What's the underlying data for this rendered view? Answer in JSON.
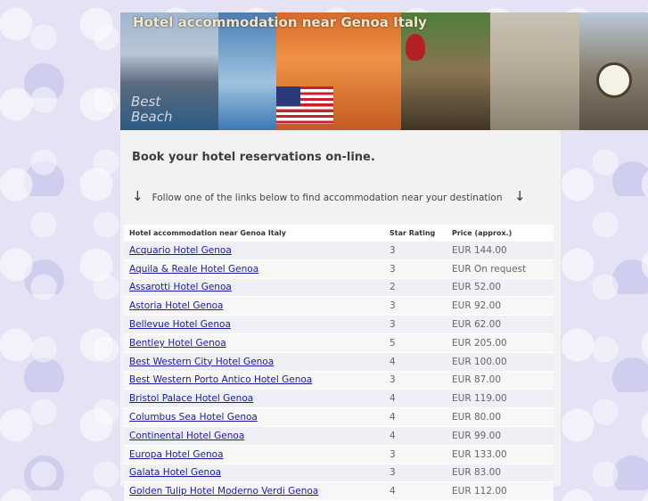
{
  "header": {
    "site_title": "Hotel accommodation near Genoa Italy",
    "banner_text": "Best Beach"
  },
  "intro": {
    "tagline": "Book your hotel reservations on-line.",
    "follow_text": "Follow one of the links below to find accommodation near your destination",
    "arrow_glyph": "↓"
  },
  "table": {
    "headers": {
      "name": "Hotel accommodation near Genoa Italy",
      "star": "Star Rating",
      "price": "Price (approx.)"
    },
    "rows": [
      {
        "name": "Acquario Hotel Genoa",
        "star": "3",
        "price": "EUR 144.00"
      },
      {
        "name": "Aquila & Reale Hotel Genoa",
        "star": "3",
        "price": "EUR On request"
      },
      {
        "name": "Assarotti Hotel Genoa",
        "star": "2",
        "price": "EUR 52.00"
      },
      {
        "name": "Astoria Hotel Genoa",
        "star": "3",
        "price": "EUR 92.00"
      },
      {
        "name": "Bellevue Hotel Genoa",
        "star": "3",
        "price": "EUR 62.00"
      },
      {
        "name": "Bentley Hotel Genoa",
        "star": "5",
        "price": "EUR 205.00"
      },
      {
        "name": "Best Western City Hotel Genoa",
        "star": "4",
        "price": "EUR 100.00"
      },
      {
        "name": "Best Western Porto Antico Hotel Genoa",
        "star": "3",
        "price": "EUR 87.00"
      },
      {
        "name": "Bristol Palace Hotel Genoa",
        "star": "4",
        "price": "EUR 119.00"
      },
      {
        "name": "Columbus Sea Hotel Genoa",
        "star": "4",
        "price": "EUR 80.00"
      },
      {
        "name": "Continental Hotel Genoa",
        "star": "4",
        "price": "EUR 99.00"
      },
      {
        "name": "Europa Hotel Genoa",
        "star": "3",
        "price": "EUR 133.00"
      },
      {
        "name": "Galata Hotel Genoa",
        "star": "3",
        "price": "EUR 83.00"
      },
      {
        "name": "Golden Tulip Hotel Moderno Verdi Genoa",
        "star": "4",
        "price": "EUR 112.00"
      }
    ]
  }
}
